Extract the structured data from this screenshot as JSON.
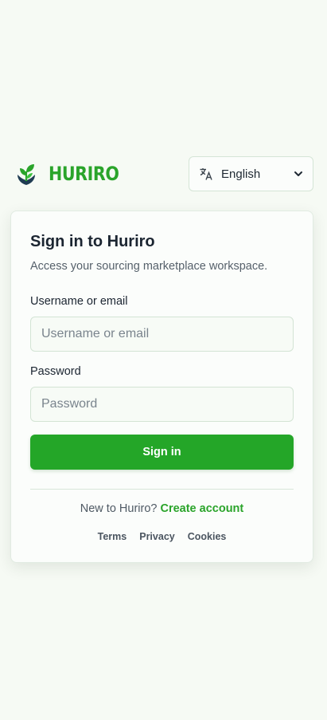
{
  "brand": {
    "name": "HURIRO",
    "logo_icon": "leaf-sprout-icon",
    "color": "#2aa42a"
  },
  "language": {
    "icon": "translate-icon",
    "selected": "English",
    "chevron_icon": "chevron-down-icon"
  },
  "card": {
    "title": "Sign in to Huriro",
    "subtitle": "Access your sourcing marketplace workspace.",
    "username": {
      "label": "Username or email",
      "placeholder": "Username or email",
      "value": ""
    },
    "password": {
      "label": "Password",
      "placeholder": "Password",
      "value": ""
    },
    "submit_label": "Sign in",
    "signup_prompt": "New to Huriro?",
    "signup_link": "Create account",
    "footer_links": [
      "Terms",
      "Privacy",
      "Cookies"
    ]
  },
  "colors": {
    "primary": "#24a628",
    "background": "#f6faf4",
    "card": "#fbfdfb"
  }
}
